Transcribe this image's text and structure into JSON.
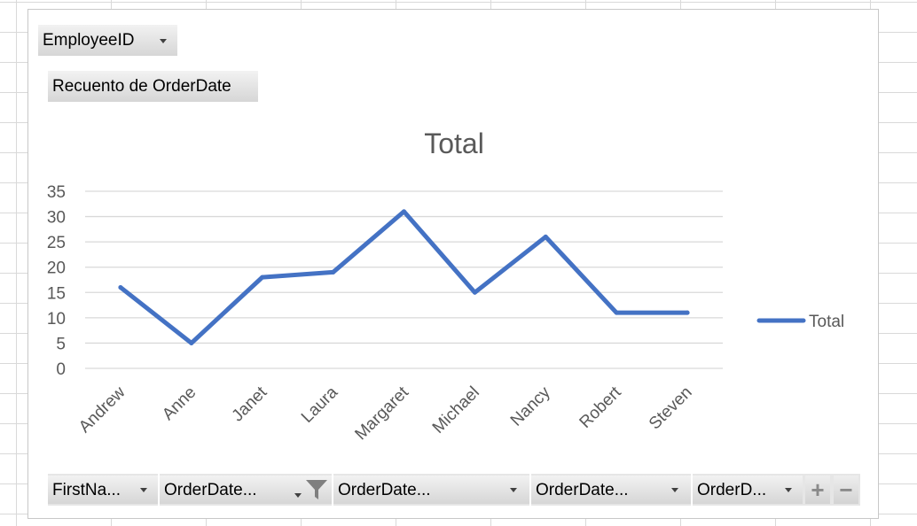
{
  "filter_field": {
    "label": "EmployeeID"
  },
  "value_field": {
    "label": "Recuento de OrderDate"
  },
  "axis_fields": [
    {
      "label": "FirstNa..."
    },
    {
      "label": "OrderDate..."
    },
    {
      "label": "OrderDate..."
    },
    {
      "label": "OrderDate..."
    },
    {
      "label": "OrderD..."
    }
  ],
  "controls": {
    "expand": "+",
    "collapse": "−"
  },
  "colors": {
    "series": "#4472c4",
    "grid": "#d9d9d9",
    "text": "#595959"
  },
  "chart_data": {
    "type": "line",
    "title": "Total",
    "xlabel": "",
    "ylabel": "",
    "categories": [
      "Andrew",
      "Anne",
      "Janet",
      "Laura",
      "Margaret",
      "Michael",
      "Nancy",
      "Robert",
      "Steven"
    ],
    "series": [
      {
        "name": "Total",
        "values": [
          16,
          5,
          18,
          19,
          31,
          15,
          26,
          11,
          11
        ]
      }
    ],
    "ylim": [
      0,
      35
    ],
    "yticks": [
      0,
      5,
      10,
      15,
      20,
      25,
      30,
      35
    ],
    "grid": true,
    "legend": "right"
  }
}
